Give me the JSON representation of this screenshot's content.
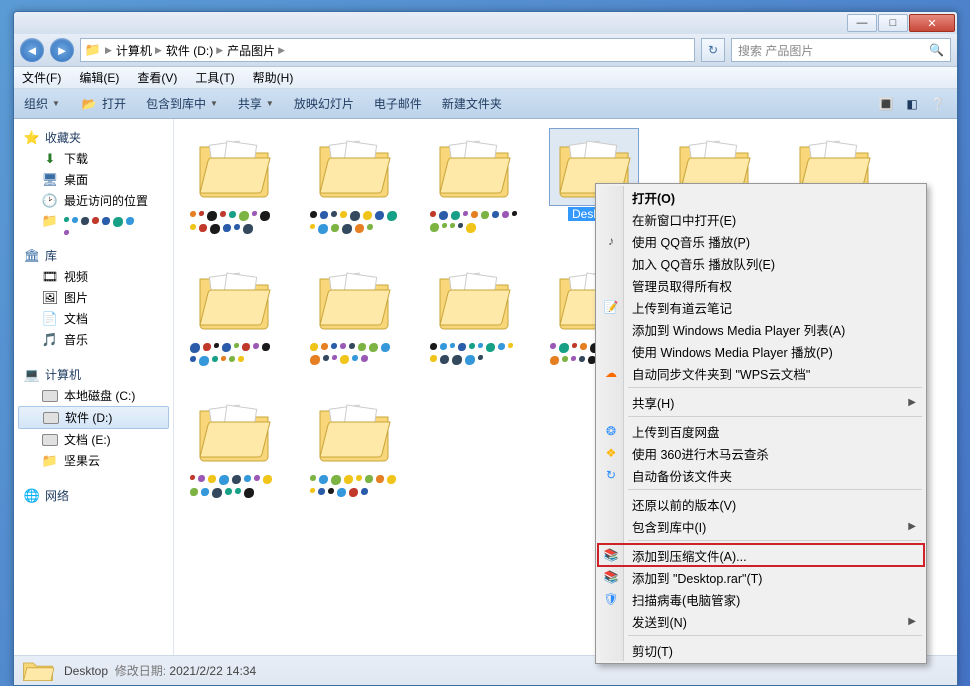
{
  "titlebar": {
    "min": "—",
    "max": "□",
    "close": "✕"
  },
  "nav": {
    "segments": [
      "计算机",
      "软件 (D:)",
      "产品图片"
    ],
    "search_placeholder": "搜索 产品图片"
  },
  "menubar": [
    "文件(F)",
    "编辑(E)",
    "查看(V)",
    "工具(T)",
    "帮助(H)"
  ],
  "toolbar": {
    "organize": "组织",
    "open": "打开",
    "include": "包含到库中",
    "share": "共享",
    "slideshow": "放映幻灯片",
    "email": "电子邮件",
    "newfolder": "新建文件夹"
  },
  "sidebar": {
    "favorites": {
      "label": "收藏夹",
      "items": [
        "下载",
        "桌面",
        "最近访问的位置"
      ]
    },
    "libraries": {
      "label": "库",
      "items": [
        "视频",
        "图片",
        "文档",
        "音乐"
      ]
    },
    "computer": {
      "label": "计算机",
      "items": [
        "本地磁盘 (C:)",
        "软件 (D:)",
        "文档 (E:)",
        "坚果云"
      ]
    },
    "network": {
      "label": "网络"
    }
  },
  "folders": {
    "selected": "Desktop"
  },
  "context_menu": {
    "items": [
      {
        "label": "打开(O)",
        "bold": true
      },
      {
        "label": "在新窗口中打开(E)"
      },
      {
        "label": "使用 QQ音乐 播放(P)",
        "icon": "qqmusic"
      },
      {
        "label": "加入 QQ音乐 播放队列(E)"
      },
      {
        "label": "管理员取得所有权"
      },
      {
        "label": "上传到有道云笔记",
        "icon": "youdao"
      },
      {
        "label": "添加到 Windows Media Player 列表(A)"
      },
      {
        "label": "使用 Windows Media Player 播放(P)"
      },
      {
        "label": "自动同步文件夹到 \"WPS云文档\"",
        "icon": "wps"
      },
      {
        "sep": true
      },
      {
        "label": "共享(H)",
        "sub": true
      },
      {
        "sep": true
      },
      {
        "label": "上传到百度网盘",
        "icon": "baidu"
      },
      {
        "label": "使用 360进行木马云查杀",
        "icon": "360"
      },
      {
        "label": "自动备份该文件夹",
        "icon": "backup"
      },
      {
        "sep": true
      },
      {
        "label": "还原以前的版本(V)"
      },
      {
        "label": "包含到库中(I)",
        "sub": true
      },
      {
        "sep": true
      },
      {
        "label": "添加到压缩文件(A)...",
        "icon": "rar",
        "boxed": true
      },
      {
        "label": "添加到 \"Desktop.rar\"(T)",
        "icon": "rar"
      },
      {
        "label": "扫描病毒(电脑管家)",
        "icon": "guanjia"
      },
      {
        "label": "发送到(N)",
        "sub": true
      },
      {
        "sep": true
      },
      {
        "label": "剪切(T)"
      }
    ]
  },
  "statusbar": {
    "name": "Desktop",
    "datelabel": "修改日期:",
    "date": "2021/2/22 14:34"
  },
  "blob_colors": [
    "#2a5caa",
    "#e67e22",
    "#7cb342",
    "#1a1a1a",
    "#f0c419",
    "#3498db",
    "#9b59b6",
    "#c0392b",
    "#16a085",
    "#34495e"
  ]
}
